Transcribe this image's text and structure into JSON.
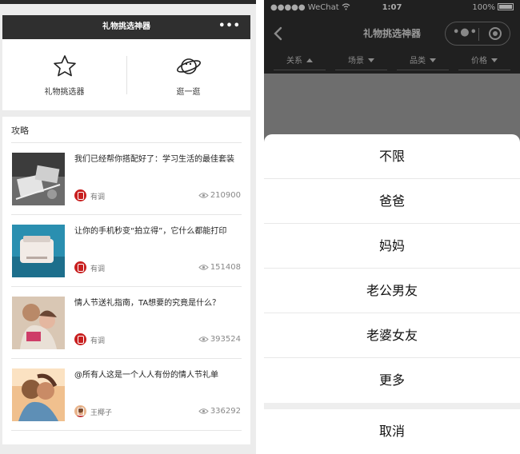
{
  "left": {
    "window_title": "礼物挑选神器",
    "more_icon": "more-dots-icon",
    "tools": [
      {
        "label": "礼物挑选器",
        "icon": "star-icon"
      },
      {
        "label": "逛一逛",
        "icon": "planet-icon"
      }
    ],
    "section_title": "攻略",
    "articles": [
      {
        "title": "我们已经帮你搭配好了：学习生活的最佳套装",
        "author": "有调",
        "views": "210900"
      },
      {
        "title": "让你的手机秒变“拍立得”，它什么都能打印",
        "author": "有调",
        "views": "151408"
      },
      {
        "title": "情人节送礼指南，TA想要的究竟是什么？",
        "author": "有调",
        "views": "393524"
      },
      {
        "title": "@所有人这是一个人人有份的情人节礼单",
        "author": "王椰子",
        "views": "336292"
      }
    ]
  },
  "right": {
    "status": {
      "carrier": "●●●●● WeChat",
      "time": "1:07",
      "battery": "100%"
    },
    "nav_title": "礼物挑选神器",
    "filters": [
      {
        "label": "关系",
        "caret": "up"
      },
      {
        "label": "场景",
        "caret": "down"
      },
      {
        "label": "品类",
        "caret": "down"
      },
      {
        "label": "价格",
        "caret": "down"
      }
    ],
    "options": [
      "不限",
      "爸爸",
      "妈妈",
      "老公男友",
      "老婆女友",
      "更多"
    ],
    "cancel": "取消"
  }
}
